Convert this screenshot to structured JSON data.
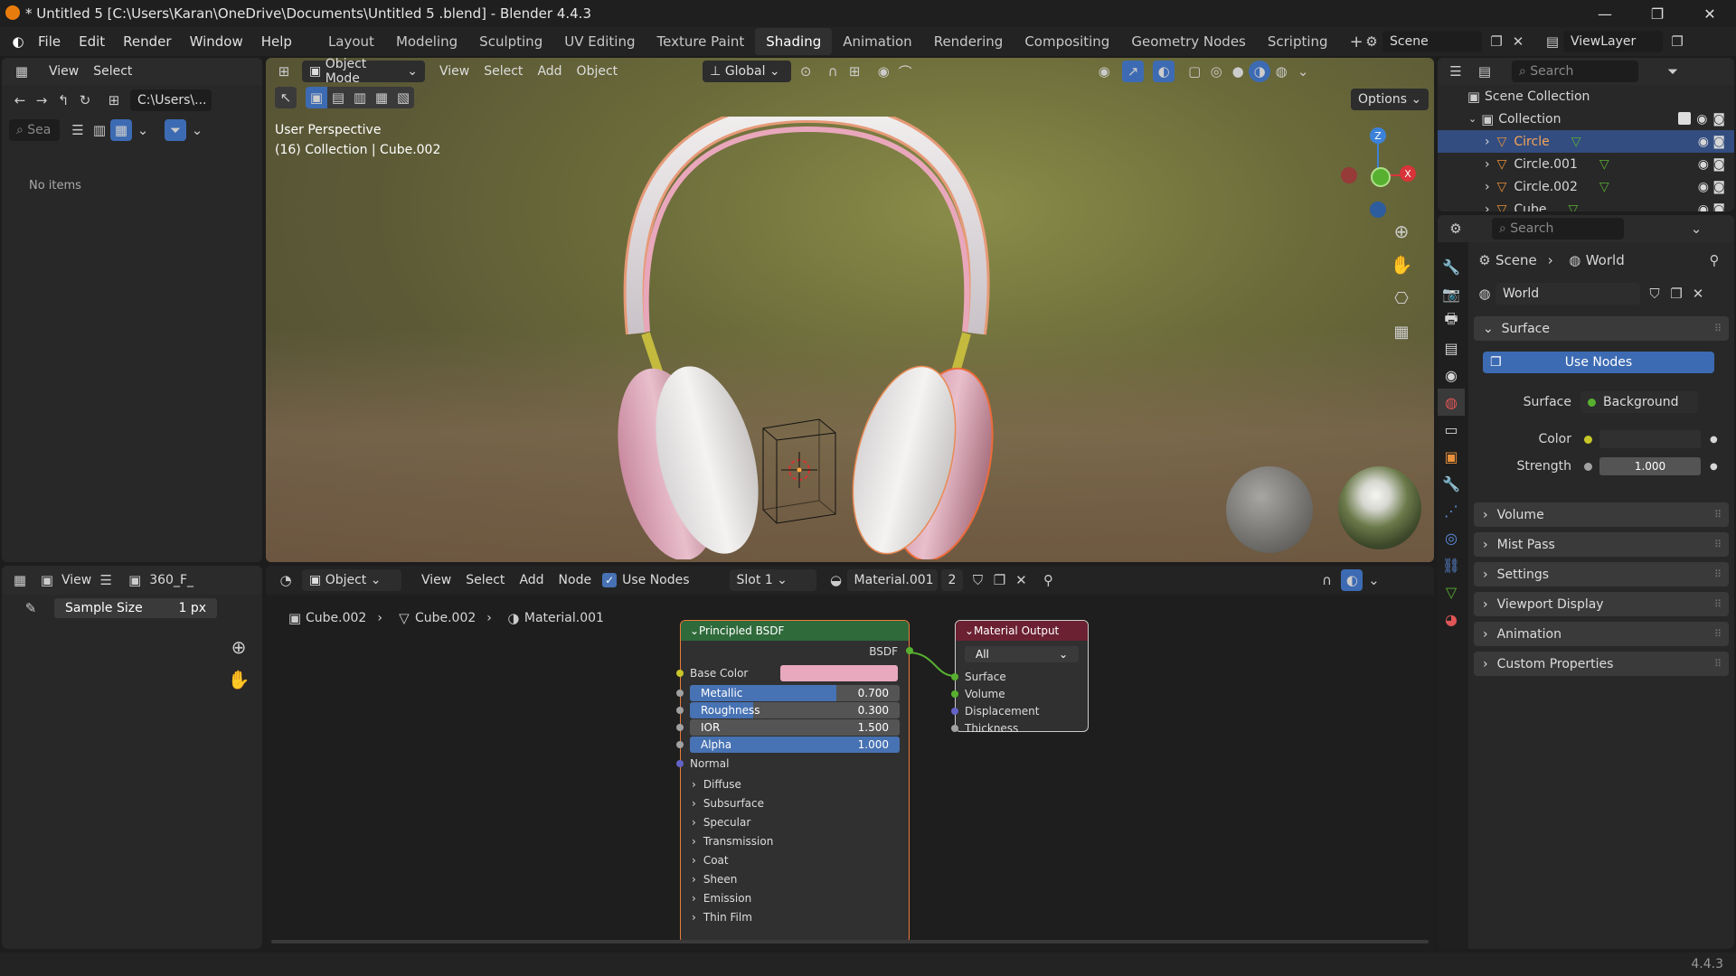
{
  "window": {
    "title": "* Untitled 5  [C:\\Users\\Karan\\OneDrive\\Documents\\Untitled 5 .blend] - Blender 4.4.3",
    "minimize": "—",
    "maximize": "❐",
    "close": "✕"
  },
  "menu": [
    "File",
    "Edit",
    "Render",
    "Window",
    "Help"
  ],
  "workspaces": [
    "Layout",
    "Modeling",
    "Sculpting",
    "UV Editing",
    "Texture Paint",
    "Shading",
    "Animation",
    "Rendering",
    "Compositing",
    "Geometry Nodes",
    "Scripting"
  ],
  "active_workspace": "Shading",
  "scene_name": "Scene",
  "view_layer": "ViewLayer",
  "file_browser": {
    "menu": [
      "View",
      "Select"
    ],
    "path": "C:\\Users\\...",
    "search_placeholder": "Sea",
    "empty_text": "No items"
  },
  "image_editor": {
    "view": "View",
    "image_name": "360_F_",
    "sample_label": "Sample Size",
    "sample_value": "1 px"
  },
  "viewport": {
    "mode": "Object Mode",
    "menu": [
      "View",
      "Select",
      "Add",
      "Object"
    ],
    "orientation": "Global",
    "options": "Options",
    "overlay_line1": "User Perspective",
    "overlay_line2": "(16) Collection | Cube.002",
    "gizmo": {
      "x": "X",
      "y": "Y",
      "z": "Z"
    }
  },
  "node_editor": {
    "type": "Object",
    "menu": [
      "View",
      "Select",
      "Add",
      "Node"
    ],
    "use_nodes": "Use Nodes",
    "slot": "Slot 1",
    "material": "Material.001",
    "users": "2",
    "breadcrumb": [
      "Cube.002",
      "Cube.002",
      "Material.001"
    ],
    "principled": {
      "title": "Principled BSDF",
      "output": "BSDF",
      "base_color_label": "Base Color",
      "base_color": "#e8a8bd",
      "fields": [
        {
          "label": "Metallic",
          "value": "0.700",
          "fraction": 0.7
        },
        {
          "label": "Roughness",
          "value": "0.300",
          "fraction": 0.3
        },
        {
          "label": "IOR",
          "value": "1.500",
          "fraction": 0
        },
        {
          "label": "Alpha",
          "value": "1.000",
          "fraction": 1.0
        }
      ],
      "normal": "Normal",
      "subpanels": [
        "Diffuse",
        "Subsurface",
        "Specular",
        "Transmission",
        "Coat",
        "Sheen",
        "Emission",
        "Thin Film"
      ]
    },
    "output": {
      "title": "Material Output",
      "target": "All",
      "inputs": [
        "Surface",
        "Volume",
        "Displacement",
        "Thickness"
      ]
    }
  },
  "outliner": {
    "search_placeholder": "Search",
    "scene_collection": "Scene Collection",
    "collection": "Collection",
    "items": [
      "Circle",
      "Circle.001",
      "Circle.002",
      "Cube"
    ]
  },
  "properties": {
    "search_placeholder": "Search",
    "breadcrumb": [
      "Scene",
      "World"
    ],
    "world_name": "World",
    "surface_panel": "Surface",
    "use_nodes": "Use Nodes",
    "surface_label": "Surface",
    "surface_value": "Background",
    "color_label": "Color",
    "strength_label": "Strength",
    "strength_value": "1.000",
    "panels": [
      "Volume",
      "Mist Pass",
      "Settings",
      "Viewport Display",
      "Animation",
      "Custom Properties"
    ]
  },
  "status": {
    "version": "4.4.3"
  },
  "colors": {
    "accent": "#4772b3",
    "shader_header": "#2f6a3b",
    "output_header": "#6b2131",
    "selected_object": "#f5a455"
  }
}
